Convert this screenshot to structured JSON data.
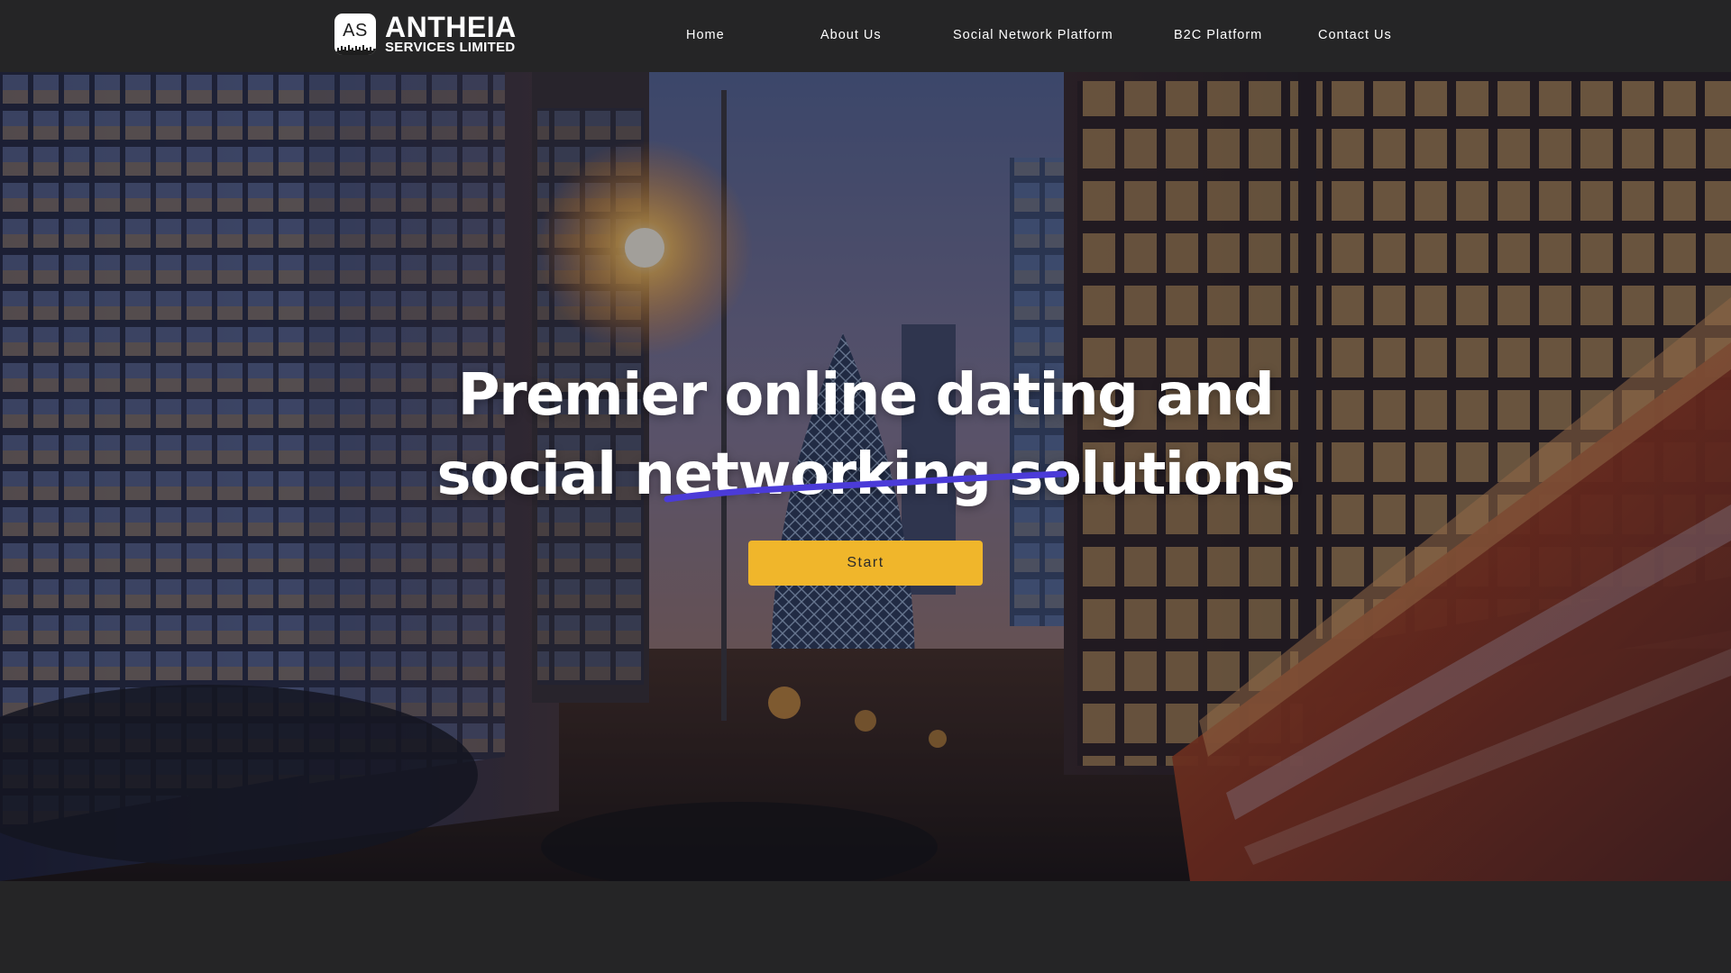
{
  "brand": {
    "mark_text": "AS",
    "name": "ANTHEIA",
    "subtitle": "SERVICES LIMITED"
  },
  "nav": {
    "items": [
      {
        "label": "Home"
      },
      {
        "label": "About Us"
      },
      {
        "label": "Social Network Platform"
      },
      {
        "label": "B2C Platform"
      },
      {
        "label": "Contact Us"
      }
    ]
  },
  "hero": {
    "title_line_1": "Premier online dating and",
    "title_line_2": "social networking  solutions",
    "cta_label": "Start",
    "background_image": "city-street-night-photo",
    "underline_color": "#4b3bd8"
  },
  "colors": {
    "header_bg": "#252526",
    "cta_bg": "#f0b62b",
    "text": "#ffffff"
  }
}
